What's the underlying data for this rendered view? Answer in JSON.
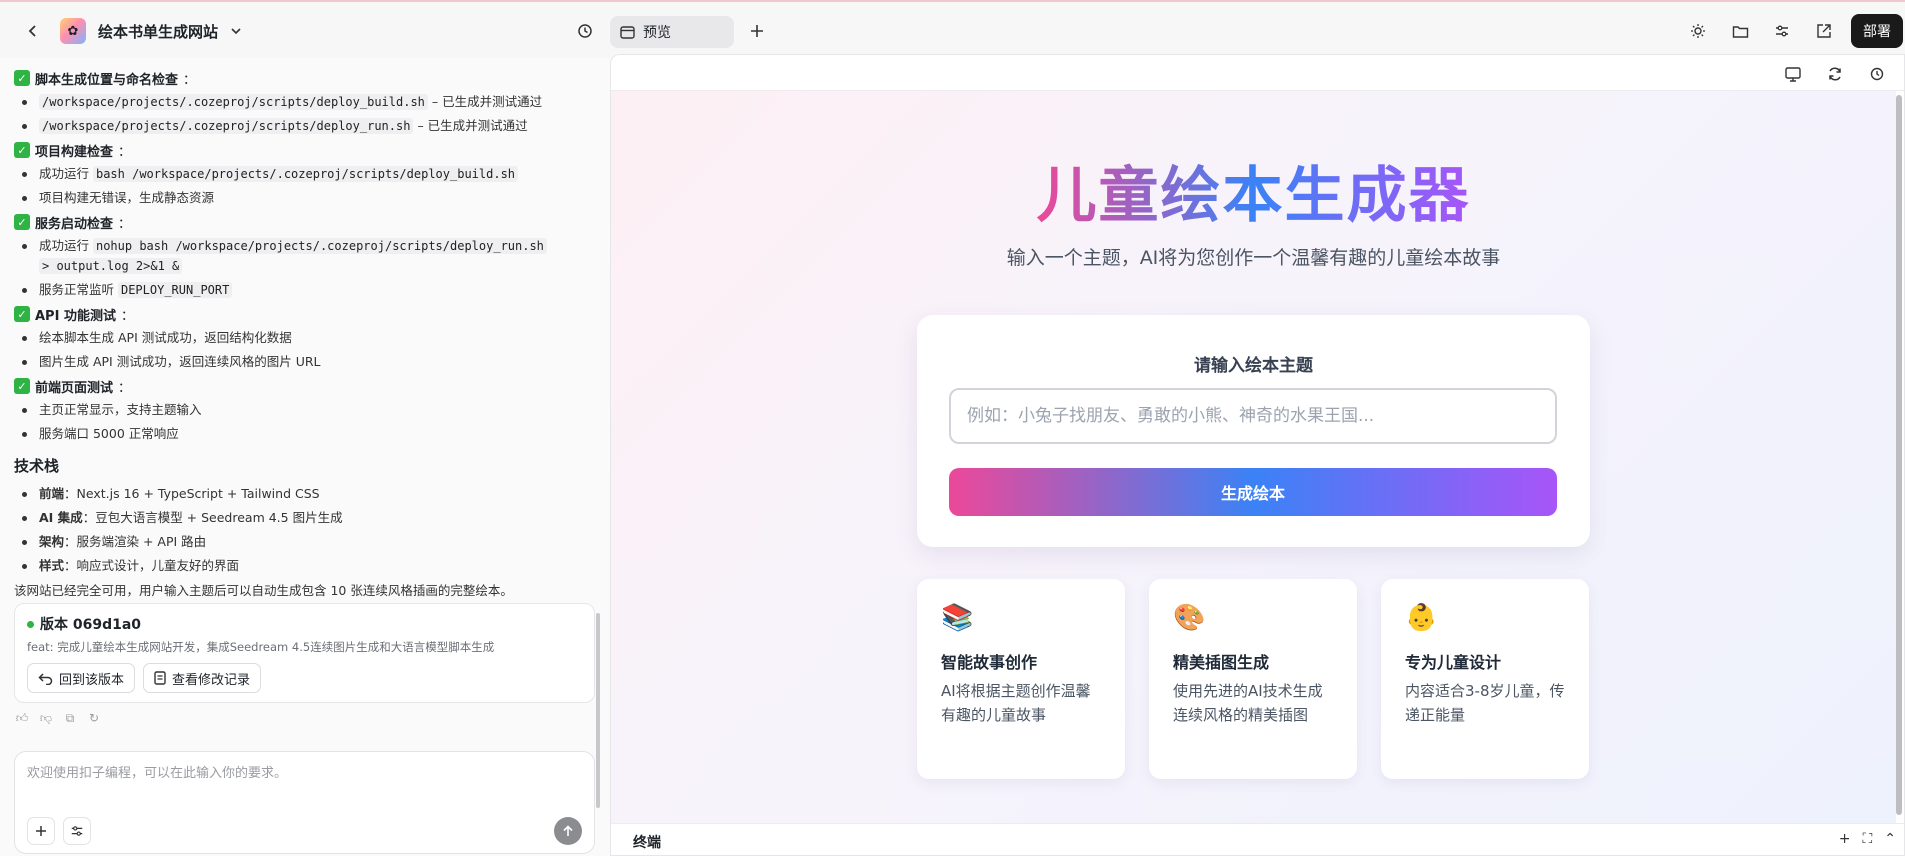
{
  "header": {
    "app_title": "绘本书单生成网站",
    "tab_preview": "预览",
    "deploy_label": "部署"
  },
  "chat": {
    "sections": [
      {
        "title": "脚本生成位置与命名检查",
        "items": [
          {
            "code": "/workspace/projects/.cozeproj/scripts/deploy_build.sh",
            "text": " – 已生成并测试通过"
          },
          {
            "code": "/workspace/projects/.cozeproj/scripts/deploy_run.sh",
            "text": " – 已生成并测试通过"
          }
        ]
      },
      {
        "title": "项目构建检查",
        "items": [
          {
            "text": "成功运行 ",
            "code": "bash /workspace/projects/.cozeproj/scripts/deploy_build.sh"
          },
          {
            "text": "项目构建无错误，生成静态资源"
          }
        ]
      },
      {
        "title": "服务启动检查",
        "items": [
          {
            "text": "成功运行 ",
            "code": "nohup bash /workspace/projects/.cozeproj/scripts/deploy_run.sh",
            "code2": "> output.log 2>&1 &"
          },
          {
            "text": "服务正常监听 ",
            "code": "DEPLOY_RUN_PORT"
          }
        ]
      },
      {
        "title": "API 功能测试",
        "items": [
          {
            "text": "绘本脚本生成 API 测试成功，返回结构化数据"
          },
          {
            "text": "图片生成 API 测试成功，返回连续风格的图片 URL"
          }
        ]
      },
      {
        "title": "前端页面测试",
        "items": [
          {
            "text": "主页正常显示，支持主题输入"
          },
          {
            "text": "服务端口 5000 正常响应"
          }
        ]
      }
    ],
    "tech_heading": "技术栈",
    "tech_items": [
      {
        "label": "前端",
        "text": "：Next.js 16 + TypeScript + Tailwind CSS"
      },
      {
        "label": "AI 集成",
        "text": "：豆包大语言模型 + Seedream 4.5 图片生成"
      },
      {
        "label": "架构",
        "text": "：服务端渲染 + API 路由"
      },
      {
        "label": "样式",
        "text": "：响应式设计，儿童友好的界面"
      }
    ],
    "summary": "该网站已经完全可用，用户输入主题后可以自动生成包含 10 张连续风格插画的完整绘本。",
    "colon": "："
  },
  "version": {
    "title": "版本 069d1a0",
    "message": "feat: 完成儿童绘本生成网站开发，集成Seedream 4.5连续图片生成和大语言模型脚本生成",
    "rollback_label": "回到该版本",
    "changes_label": "查看修改记录"
  },
  "composer": {
    "placeholder": "欢迎使用扣子编程，可以在此输入你的要求。"
  },
  "preview": {
    "hero_title": "儿童绘本生成器",
    "hero_subtitle": "输入一个主题，AI将为您创作一个温馨有趣的儿童绘本故事",
    "form_label": "请输入绘本主题",
    "input_placeholder": "例如：小兔子找朋友、勇敢的小熊、神奇的水果王国...",
    "generate_label": "生成绘本",
    "features": [
      {
        "emoji": "📚",
        "title": "智能故事创作",
        "desc": "AI将根据主题创作温馨有趣的儿童故事"
      },
      {
        "emoji": "🎨",
        "title": "精美插图生成",
        "desc": "使用先进的AI技术生成连续风格的精美插图"
      },
      {
        "emoji": "👶",
        "title": "专为儿童设计",
        "desc": "内容适合3-8岁儿童，传递正能量"
      }
    ],
    "terminal_label": "终端"
  },
  "colors": {
    "gradient_pink": "#ec4899",
    "gradient_blue": "#3b82f6",
    "gradient_purple": "#a855f7",
    "check_green": "#2fb344"
  }
}
